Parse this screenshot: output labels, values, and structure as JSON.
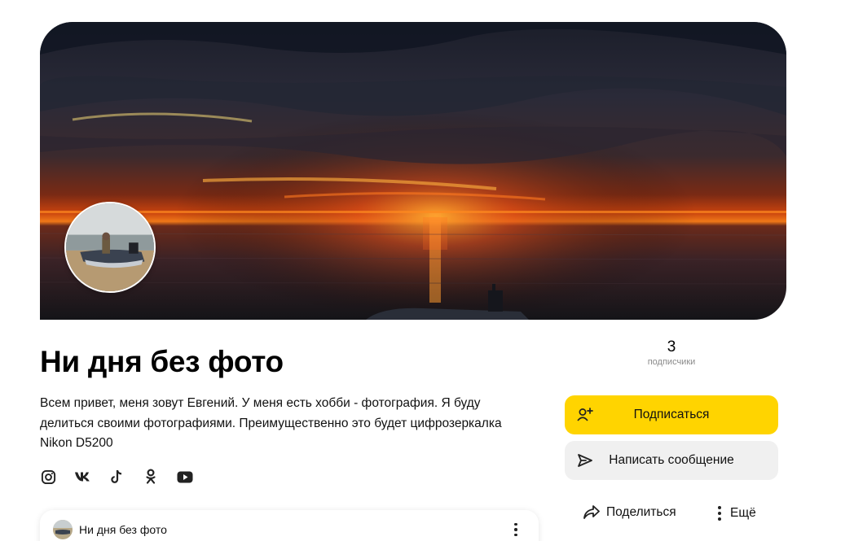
{
  "channel": {
    "title": "Ни дня без фото",
    "description": "Всем привет, меня зовут Евгений. У меня есть хобби - фотография. Я буду делиться своими фотографиями. Преимущественно это будет цифрозеркалка Nikon D5200",
    "subscribers_count": "3",
    "subscribers_label": "подписчики"
  },
  "socials": [
    {
      "icon": "instagram-icon"
    },
    {
      "icon": "vk-icon"
    },
    {
      "icon": "tiktok-icon"
    },
    {
      "icon": "odnoklassniki-icon"
    },
    {
      "icon": "youtube-icon"
    }
  ],
  "actions": {
    "subscribe_label": "Подписаться",
    "message_label": "Написать сообщение",
    "share_label": "Поделиться",
    "more_label": "Ещё"
  },
  "post": {
    "author": "Ни дня без фото"
  },
  "colors": {
    "subscribe_button": "#ffd400",
    "message_button": "#f0f0f0",
    "secondary_text": "#8a8a8a"
  }
}
